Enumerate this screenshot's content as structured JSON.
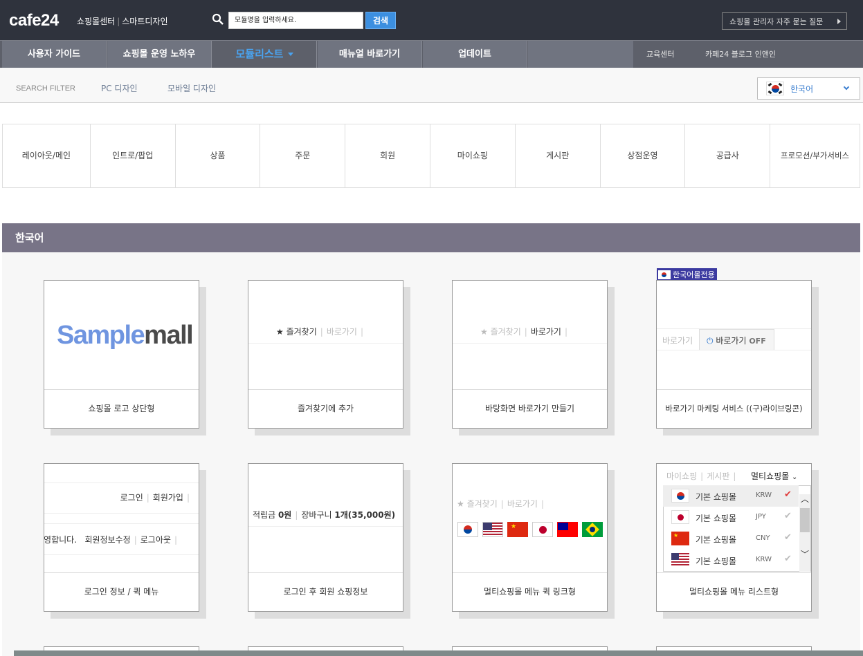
{
  "header": {
    "logo": "cafe24",
    "logo_sub_1": "쇼핑몰센터",
    "logo_sub_2": "스마트디자인",
    "search_placeholder": "모듈명을 입력하세요.",
    "search_button": "검색",
    "faq_button": "쇼핑몰 관리자 자주 묻는 질문"
  },
  "nav": {
    "items": [
      "사용자 가이드",
      "쇼핑몰 운영 노하우",
      "모듈리스트",
      "매뉴얼 바로가기",
      "업데이트"
    ],
    "small_links": [
      "교육센터",
      "카페24 블로그 인앤인"
    ]
  },
  "filter": {
    "label": "SEARCH FILTER",
    "pc": "PC 디자인",
    "mobile": "모바일 디자인",
    "language": "한국어"
  },
  "categories": [
    "레이아웃/메인",
    "인트로/팝업",
    "상품",
    "주문",
    "회원",
    "마이쇼핑",
    "게시판",
    "상점운영",
    "공급사",
    "프로모션/부가서비스"
  ],
  "section": {
    "title": "한국어",
    "badge": "한국어몰전용"
  },
  "cards": {
    "logo_top": {
      "brand_a": "Sample",
      "brand_b": "mall",
      "label": "쇼핑몰 로고 상단형"
    },
    "favorite": {
      "fav": "즐겨찾기",
      "shortcut": "바로가기",
      "label": "즐겨찾기에 추가"
    },
    "desktop_shortcut": {
      "fav": "즐겨찾기",
      "shortcut": "바로가기",
      "label": "바탕화면 바로가기 만들기"
    },
    "marketing": {
      "shortcut": "바로가기",
      "shortcut_off_label": "바로가기",
      "off": "OFF",
      "label": "바로가기 마케팅 서비스 ((구)라이브링콘)"
    },
    "login_info": {
      "login": "로그인",
      "join": "회원가입",
      "welcome": "환영합니다.",
      "edit": "회원정보수정",
      "logout": "로그아웃",
      "label": "로그인 정보 / 퀵 메뉴"
    },
    "member_info": {
      "points_label": "적립금",
      "points_value": "0원",
      "cart_label": "장바구니",
      "cart_value": "1개(35,000원)",
      "label": "로그인 후 회원 쇼핑정보"
    },
    "multi_link": {
      "fav": "즐겨찾기",
      "shortcut": "바로가기",
      "label": "멀티쇼핑몰 메뉴 퀵 링크형"
    },
    "multi_list": {
      "top_links": [
        "마이쇼핑",
        "게시판"
      ],
      "select_value": "멀티쇼핑몰",
      "rows": [
        {
          "name": "기본 쇼핑몰",
          "currency": "KRW",
          "checked": true
        },
        {
          "name": "기본 쇼핑몰",
          "currency": "JPY",
          "checked": false
        },
        {
          "name": "기본 쇼핑몰",
          "currency": "CNY",
          "checked": false
        },
        {
          "name": "기본 쇼핑몰",
          "currency": "KRW",
          "checked": false
        }
      ],
      "label": "멀티쇼핑몰 메뉴 리스트형"
    }
  }
}
